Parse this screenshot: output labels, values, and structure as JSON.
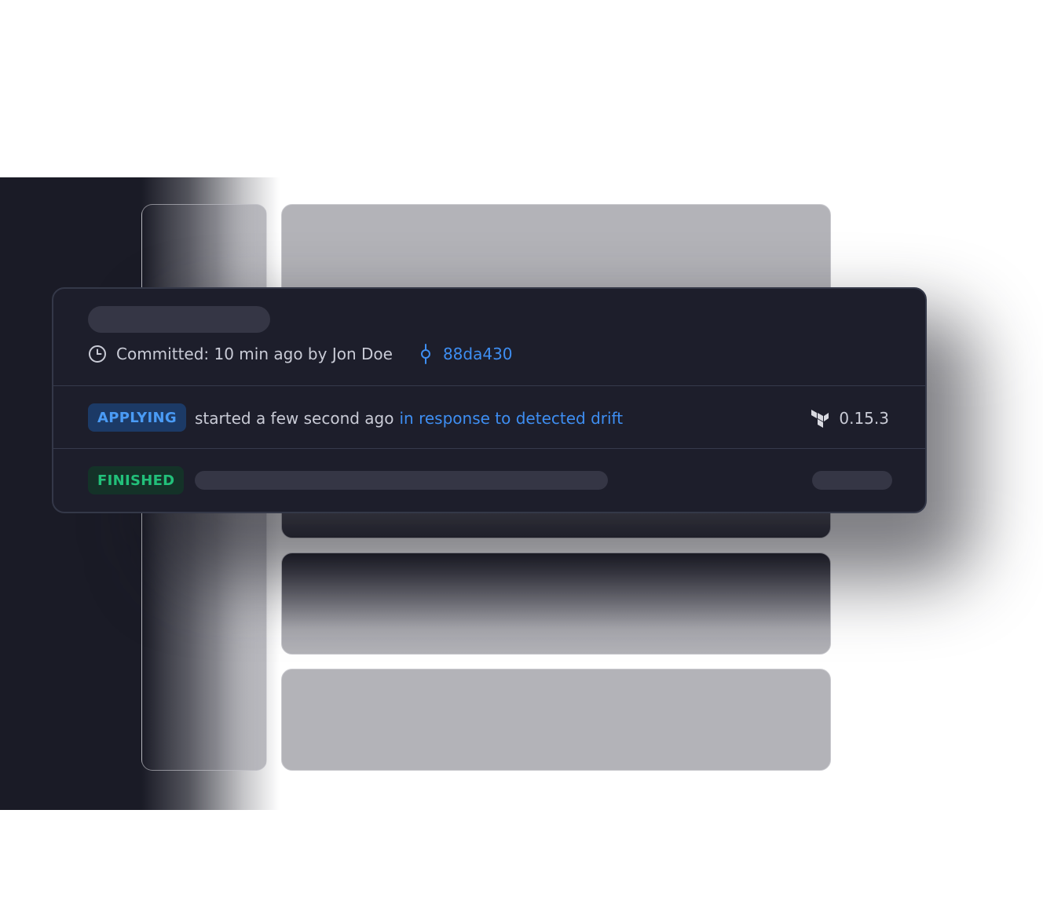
{
  "run": {
    "commit_text": "Committed: 10 min ago by Jon Doe",
    "commit_hash": "88da430"
  },
  "applying": {
    "badge": "APPLYING",
    "status_text": "started a few second ago",
    "status_link": "in response to detected drift",
    "version": "0.15.3"
  },
  "finished": {
    "badge": "FINISHED"
  },
  "icons": {
    "clock": "clock-icon",
    "commit": "git-commit-icon",
    "terraform": "terraform-icon"
  },
  "colors": {
    "accent_blue": "#3e8ef2",
    "applying_bg": "#1c3a66",
    "finished_text": "#22c07a",
    "finished_bg": "#143228",
    "card_bg": "#1d1e2b"
  }
}
